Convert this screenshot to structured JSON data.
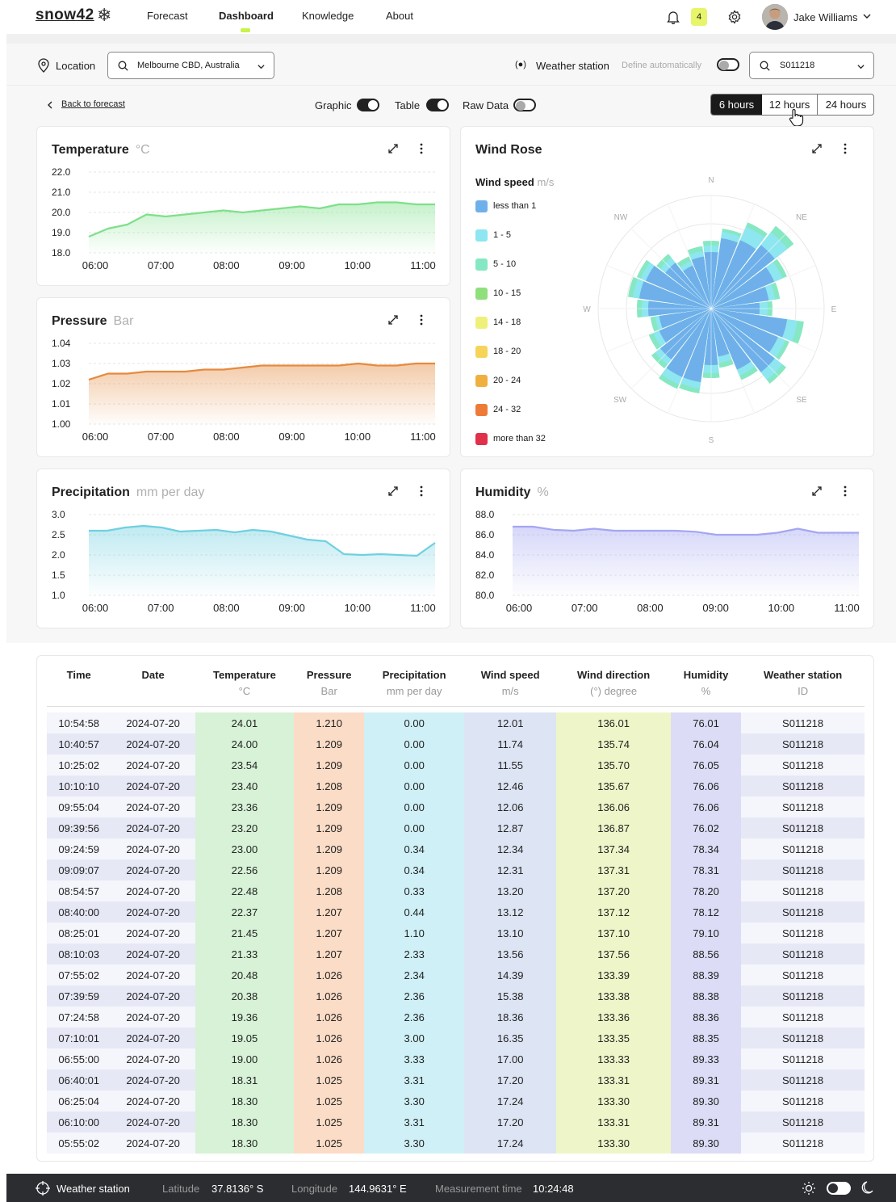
{
  "header": {
    "logo": "snow42",
    "nav": [
      "Forecast",
      "Dashboard",
      "Knowledge",
      "About"
    ],
    "notifications": "4",
    "user": "Jake Williams"
  },
  "location": {
    "label": "Location",
    "value": "Melbourne CBD, Australia",
    "station_label": "Weather station",
    "station_auto": "Define automatically",
    "station_id": "S011218"
  },
  "controls": {
    "back": "Back to forecast",
    "graphic": "Graphic",
    "table": "Table",
    "raw": "Raw Data",
    "ranges": [
      "6 hours",
      "12 hours",
      "24 hours"
    ]
  },
  "charts": {
    "temperature": {
      "title": "Temperature",
      "unit": "°C"
    },
    "pressure": {
      "title": "Pressure",
      "unit": "Bar"
    },
    "precipitation": {
      "title": "Precipitation",
      "unit": "mm per day"
    },
    "humidity": {
      "title": "Humidity",
      "unit": "%"
    },
    "windrose": {
      "title": "Wind Rose",
      "legend_title": "Wind speed",
      "legend_unit": "m/s"
    }
  },
  "chart_data": [
    {
      "type": "area",
      "title": "Temperature",
      "unit": "°C",
      "x": [
        "06:00",
        "07:00",
        "08:00",
        "09:00",
        "10:00",
        "11:00"
      ],
      "ylim": [
        18,
        22
      ],
      "yticks": [
        "22.0",
        "21.0",
        "20.0",
        "19.0",
        "18.0"
      ],
      "color": "#7ee08a",
      "values": [
        18.8,
        19.2,
        19.4,
        19.9,
        19.8,
        19.9,
        20.0,
        20.1,
        20.0,
        20.1,
        20.2,
        20.3,
        20.2,
        20.4,
        20.4,
        20.5,
        20.5,
        20.4,
        20.4
      ]
    },
    {
      "type": "area",
      "title": "Pressure",
      "unit": "Bar",
      "x": [
        "06:00",
        "07:00",
        "08:00",
        "09:00",
        "10:00",
        "11:00"
      ],
      "ylim": [
        1.0,
        1.04
      ],
      "yticks": [
        "1.04",
        "1.03",
        "1.02",
        "1.01",
        "1.00"
      ],
      "color": "#e58a3e",
      "values": [
        1.022,
        1.025,
        1.025,
        1.026,
        1.026,
        1.026,
        1.027,
        1.027,
        1.028,
        1.029,
        1.029,
        1.029,
        1.029,
        1.029,
        1.03,
        1.029,
        1.029,
        1.03,
        1.03
      ]
    },
    {
      "type": "area",
      "title": "Precipitation",
      "unit": "mm per day",
      "x": [
        "06:00",
        "07:00",
        "08:00",
        "09:00",
        "10:00",
        "11:00"
      ],
      "ylim": [
        1.0,
        3.0
      ],
      "yticks": [
        "3.0",
        "2.5",
        "2.0",
        "1.5",
        "1.0"
      ],
      "color": "#6fd0e0",
      "values": [
        2.6,
        2.6,
        2.68,
        2.72,
        2.68,
        2.58,
        2.6,
        2.62,
        2.56,
        2.62,
        2.58,
        2.48,
        2.38,
        2.34,
        2.02,
        2.0,
        2.02,
        2.0,
        1.98,
        2.3
      ]
    },
    {
      "type": "area",
      "title": "Humidity",
      "unit": "%",
      "x": [
        "06:00",
        "07:00",
        "08:00",
        "09:00",
        "10:00",
        "11:00"
      ],
      "ylim": [
        80,
        88
      ],
      "yticks": [
        "88.0",
        "86.0",
        "84.0",
        "82.0",
        "80.0"
      ],
      "color": "#a4a6f2",
      "values": [
        86.8,
        86.8,
        86.5,
        86.4,
        86.6,
        86.4,
        86.4,
        86.4,
        86.4,
        86.3,
        86.0,
        86.0,
        86.0,
        86.2,
        86.6,
        86.2,
        86.2,
        86.2
      ]
    },
    {
      "type": "wind-rose",
      "title": "Wind Rose",
      "directions": [
        "N",
        "NE",
        "E",
        "SE",
        "S",
        "SW",
        "W",
        "NW"
      ],
      "legend": [
        {
          "label": "less than 1",
          "color": "#6fb0ea"
        },
        {
          "label": "1 - 5",
          "color": "#8ee6f0"
        },
        {
          "label": "5 - 10",
          "color": "#86e8c2"
        },
        {
          "label": "10 - 15",
          "color": "#8fe07c"
        },
        {
          "label": "14 - 18",
          "color": "#eef07a"
        },
        {
          "label": "18 - 20",
          "color": "#f6d45a"
        },
        {
          "label": "20 - 24",
          "color": "#f0b040"
        },
        {
          "label": "24 - 32",
          "color": "#ee7a38"
        },
        {
          "label": "more than 32",
          "color": "#e0304a"
        }
      ]
    }
  ],
  "table": {
    "headers": [
      {
        "name": "Time",
        "unit": ""
      },
      {
        "name": "Date",
        "unit": ""
      },
      {
        "name": "Temperature",
        "unit": "°C"
      },
      {
        "name": "Pressure",
        "unit": "Bar"
      },
      {
        "name": "Precipitation",
        "unit": "mm per day"
      },
      {
        "name": "Wind speed",
        "unit": "m/s"
      },
      {
        "name": "Wind direction",
        "unit": "(°) degree"
      },
      {
        "name": "Humidity",
        "unit": "%"
      },
      {
        "name": "Weather station",
        "unit": "ID"
      }
    ],
    "col_colors": [
      "#eef0fb",
      "#eef0fb",
      "#d7f2d6",
      "#fbdcc6",
      "#cff0f6",
      "#dde4f4",
      "#eef5c8",
      "#dcdcf6",
      "#eef0fb"
    ],
    "rows": [
      [
        "10:54:58",
        "2024-07-20",
        "24.01",
        "1.210",
        "0.00",
        "12.01",
        "136.01",
        "76.01",
        "S011218"
      ],
      [
        "10:40:57",
        "2024-07-20",
        "24.00",
        "1.209",
        "0.00",
        "11.74",
        "135.74",
        "76.04",
        "S011218"
      ],
      [
        "10:25:02",
        "2024-07-20",
        "23.54",
        "1.209",
        "0.00",
        "11.55",
        "135.70",
        "76.05",
        "S011218"
      ],
      [
        "10:10:10",
        "2024-07-20",
        "23.40",
        "1.208",
        "0.00",
        "12.46",
        "135.67",
        "76.06",
        "S011218"
      ],
      [
        "09:55:04",
        "2024-07-20",
        "23.36",
        "1.209",
        "0.00",
        "12.06",
        "136.06",
        "76.06",
        "S011218"
      ],
      [
        "09:39:56",
        "2024-07-20",
        "23.20",
        "1.209",
        "0.00",
        "12.87",
        "136.87",
        "76.02",
        "S011218"
      ],
      [
        "09:24:59",
        "2024-07-20",
        "23.00",
        "1.209",
        "0.34",
        "12.34",
        "137.34",
        "78.34",
        "S011218"
      ],
      [
        "09:09:07",
        "2024-07-20",
        "22.56",
        "1.209",
        "0.34",
        "12.31",
        "137.31",
        "78.31",
        "S011218"
      ],
      [
        "08:54:57",
        "2024-07-20",
        "22.48",
        "1.208",
        "0.33",
        "13.20",
        "137.20",
        "78.20",
        "S011218"
      ],
      [
        "08:40:00",
        "2024-07-20",
        "22.37",
        "1.207",
        "0.44",
        "13.12",
        "137.12",
        "78.12",
        "S011218"
      ],
      [
        "08:25:01",
        "2024-07-20",
        "21.45",
        "1.207",
        "1.10",
        "13.10",
        "137.10",
        "79.10",
        "S011218"
      ],
      [
        "08:10:03",
        "2024-07-20",
        "21.33",
        "1.207",
        "2.33",
        "13.56",
        "137.56",
        "88.56",
        "S011218"
      ],
      [
        "07:55:02",
        "2024-07-20",
        "20.48",
        "1.026",
        "2.34",
        "14.39",
        "133.39",
        "88.39",
        "S011218"
      ],
      [
        "07:39:59",
        "2024-07-20",
        "20.38",
        "1.026",
        "2.36",
        "15.38",
        "133.38",
        "88.38",
        "S011218"
      ],
      [
        "07:24:58",
        "2024-07-20",
        "19.36",
        "1.026",
        "2.36",
        "18.36",
        "133.36",
        "88.36",
        "S011218"
      ],
      [
        "07:10:01",
        "2024-07-20",
        "19.05",
        "1.026",
        "3.00",
        "16.35",
        "133.35",
        "88.35",
        "S011218"
      ],
      [
        "06:55:00",
        "2024-07-20",
        "19.00",
        "1.026",
        "3.33",
        "17.00",
        "133.33",
        "89.33",
        "S011218"
      ],
      [
        "06:40:01",
        "2024-07-20",
        "18.31",
        "1.025",
        "3.31",
        "17.20",
        "133.31",
        "89.31",
        "S011218"
      ],
      [
        "06:25:04",
        "2024-07-20",
        "18.30",
        "1.025",
        "3.30",
        "17.24",
        "133.30",
        "89.30",
        "S011218"
      ],
      [
        "06:10:00",
        "2024-07-20",
        "18.30",
        "1.025",
        "3.31",
        "17.20",
        "133.31",
        "89.31",
        "S011218"
      ],
      [
        "05:55:02",
        "2024-07-20",
        "18.30",
        "1.025",
        "3.30",
        "17.24",
        "133.30",
        "89.30",
        "S011218"
      ]
    ]
  },
  "footer": {
    "station": "Weather station",
    "lat_label": "Latitude",
    "lat": "37.8136° S",
    "lon_label": "Longitude",
    "lon": "144.9631° E",
    "time_label": "Measurement time",
    "time": "10:24:48"
  }
}
